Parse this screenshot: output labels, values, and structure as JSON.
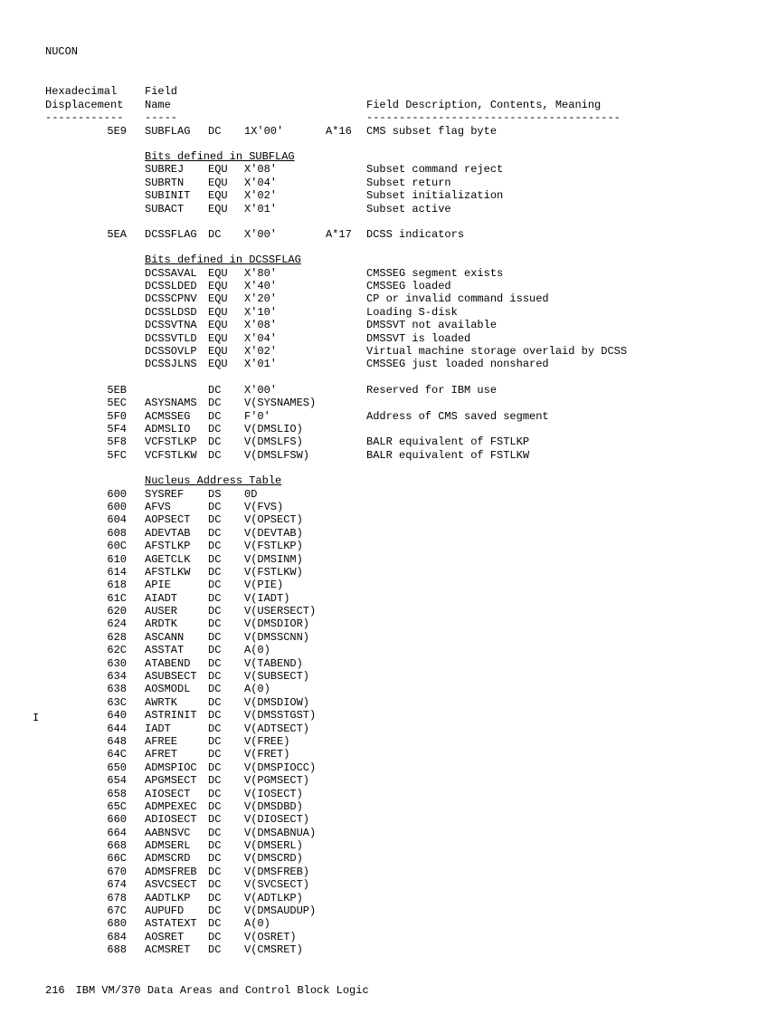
{
  "doc": {
    "header": "NUCON",
    "col_header1a": "Hexadecimal",
    "col_header1b": "Displacement",
    "col_header2a": "Field",
    "col_header2b": "Name",
    "col_header3": "Field Description, Contents, Meaning",
    "dash1": "------------",
    "dash2": "-----",
    "dash3": "---------------------------------------",
    "section1": "Bits defined in SUBFLAG",
    "section2": "Bits defined in DCSSFLAG",
    "section3": "Nucleus Address Table",
    "footer_page": "216",
    "footer_title": "IBM VM/370 Data Areas and Control Block Logic",
    "side_mark": "I"
  },
  "rows": {
    "r1": {
      "disp": "5E9",
      "name": "SUBFLAG",
      "op": "DC",
      "val": "1X'00'",
      "mod": "A*16",
      "desc": "CMS subset flag byte"
    },
    "r2": {
      "disp": "",
      "name": "SUBREJ",
      "op": "EQU",
      "val": "X'08'",
      "mod": "",
      "desc": "Subset command reject"
    },
    "r3": {
      "disp": "",
      "name": "SUBRTN",
      "op": "EQU",
      "val": "X'04'",
      "mod": "",
      "desc": "Subset return"
    },
    "r4": {
      "disp": "",
      "name": "SUBINIT",
      "op": "EQU",
      "val": "X'02'",
      "mod": "",
      "desc": "Subset initialization"
    },
    "r5": {
      "disp": "",
      "name": "SUBACT",
      "op": "EQU",
      "val": "X'01'",
      "mod": "",
      "desc": "Subset active"
    },
    "r6": {
      "disp": "5EA",
      "name": "DCSSFLAG",
      "op": "DC",
      "val": "X'00'",
      "mod": "A*17",
      "desc": "DCSS indicators"
    },
    "r7": {
      "disp": "",
      "name": "DCSSAVAL",
      "op": "EQU",
      "val": "X'80'",
      "mod": "",
      "desc": "CMSSEG segment exists"
    },
    "r8": {
      "disp": "",
      "name": "DCSSLDED",
      "op": "EQU",
      "val": "X'40'",
      "mod": "",
      "desc": "CMSSEG loaded"
    },
    "r9": {
      "disp": "",
      "name": "DCSSCPNV",
      "op": "EQU",
      "val": "X'20'",
      "mod": "",
      "desc": "CP or invalid command issued"
    },
    "r10": {
      "disp": "",
      "name": "DCSSLDSD",
      "op": "EQU",
      "val": "X'10'",
      "mod": "",
      "desc": "Loading S-disk"
    },
    "r11": {
      "disp": "",
      "name": "DCSSVTNA",
      "op": "EQU",
      "val": "X'08'",
      "mod": "",
      "desc": "DMSSVT not available"
    },
    "r12": {
      "disp": "",
      "name": "DCSSVTLD",
      "op": "EQU",
      "val": "X'04'",
      "mod": "",
      "desc": "DMSSVT is loaded"
    },
    "r13": {
      "disp": "",
      "name": "DCSSOVLP",
      "op": "EQU",
      "val": "X'02'",
      "mod": "",
      "desc": "Virtual machine storage overlaid by DCSS"
    },
    "r14": {
      "disp": "",
      "name": "DCSSJLNS",
      "op": "EQU",
      "val": "X'01'",
      "mod": "",
      "desc": "CMSSEG just loaded nonshared"
    },
    "r15": {
      "disp": "5EB",
      "name": "",
      "op": "DC",
      "val": "X'00'",
      "mod": "",
      "desc": "Reserved for IBM use"
    },
    "r16": {
      "disp": "5EC",
      "name": "ASYSNAMS",
      "op": "DC",
      "val": "V(SYSNAMES)",
      "mod": "",
      "desc": ""
    },
    "r17": {
      "disp": "5F0",
      "name": "ACMSSEG",
      "op": "DC",
      "val": "F'0'",
      "mod": "",
      "desc": "Address of CMS saved segment"
    },
    "r18": {
      "disp": "5F4",
      "name": "ADMSLIO",
      "op": "DC",
      "val": "V(DMSLIO)",
      "mod": "",
      "desc": ""
    },
    "r19": {
      "disp": "5F8",
      "name": "VCFSTLKP",
      "op": "DC",
      "val": "V(DMSLFS)",
      "mod": "",
      "desc": "BALR equivalent of FSTLKP"
    },
    "r20": {
      "disp": "5FC",
      "name": "VCFSTLKW",
      "op": "DC",
      "val": "V(DMSLFSW)",
      "mod": "",
      "desc": "BALR equivalent of FSTLKW"
    },
    "r21": {
      "disp": "600",
      "name": "SYSREF",
      "op": "DS",
      "val": "0D",
      "mod": "",
      "desc": ""
    },
    "r22": {
      "disp": "600",
      "name": "AFVS",
      "op": "DC",
      "val": "V(FVS)",
      "mod": "",
      "desc": ""
    },
    "r23": {
      "disp": "604",
      "name": "AOPSECT",
      "op": "DC",
      "val": "V(OPSECT)",
      "mod": "",
      "desc": ""
    },
    "r24": {
      "disp": "608",
      "name": "ADEVTAB",
      "op": "DC",
      "val": "V(DEVTAB)",
      "mod": "",
      "desc": ""
    },
    "r25": {
      "disp": "60C",
      "name": "AFSTLKP",
      "op": "DC",
      "val": "V(FSTLKP)",
      "mod": "",
      "desc": ""
    },
    "r26": {
      "disp": "610",
      "name": "AGETCLK",
      "op": "DC",
      "val": "V(DMSINM)",
      "mod": "",
      "desc": ""
    },
    "r27": {
      "disp": "614",
      "name": "AFSTLKW",
      "op": "DC",
      "val": "V(FSTLKW)",
      "mod": "",
      "desc": ""
    },
    "r28": {
      "disp": "618",
      "name": "APIE",
      "op": "DC",
      "val": "V(PIE)",
      "mod": "",
      "desc": ""
    },
    "r29": {
      "disp": "61C",
      "name": "AIADT",
      "op": "DC",
      "val": "V(IADT)",
      "mod": "",
      "desc": ""
    },
    "r30": {
      "disp": "620",
      "name": "AUSER",
      "op": "DC",
      "val": "V(USERSECT)",
      "mod": "",
      "desc": ""
    },
    "r31": {
      "disp": "624",
      "name": "ARDTK",
      "op": "DC",
      "val": "V(DMSDIOR)",
      "mod": "",
      "desc": ""
    },
    "r32": {
      "disp": "628",
      "name": "ASCANN",
      "op": "DC",
      "val": "V(DMSSCNN)",
      "mod": "",
      "desc": ""
    },
    "r33": {
      "disp": "62C",
      "name": "ASSTAT",
      "op": "DC",
      "val": "A(0)",
      "mod": "",
      "desc": ""
    },
    "r34": {
      "disp": "630",
      "name": "ATABEND",
      "op": "DC",
      "val": "V(TABEND)",
      "mod": "",
      "desc": ""
    },
    "r35": {
      "disp": "634",
      "name": "ASUBSECT",
      "op": "DC",
      "val": "V(SUBSECT)",
      "mod": "",
      "desc": ""
    },
    "r36": {
      "disp": "638",
      "name": "AOSMODL",
      "op": "DC",
      "val": "A(0)",
      "mod": "",
      "desc": ""
    },
    "r37": {
      "disp": "63C",
      "name": "AWRTK",
      "op": "DC",
      "val": "V(DMSDIOW)",
      "mod": "",
      "desc": ""
    },
    "r38": {
      "disp": "640",
      "name": "ASTRINIT",
      "op": "DC",
      "val": "V(DMSSTGST)",
      "mod": "",
      "desc": ""
    },
    "r39": {
      "disp": "644",
      "name": "IADT",
      "op": "DC",
      "val": "V(ADTSECT)",
      "mod": "",
      "desc": ""
    },
    "r40": {
      "disp": "648",
      "name": "AFREE",
      "op": "DC",
      "val": "V(FREE)",
      "mod": "",
      "desc": ""
    },
    "r41": {
      "disp": "64C",
      "name": "AFRET",
      "op": "DC",
      "val": "V(FRET)",
      "mod": "",
      "desc": ""
    },
    "r42": {
      "disp": "650",
      "name": "ADMSPIOC",
      "op": "DC",
      "val": "V(DMSPIOCC)",
      "mod": "",
      "desc": ""
    },
    "r43": {
      "disp": "654",
      "name": "APGMSECT",
      "op": "DC",
      "val": "V(PGMSECT)",
      "mod": "",
      "desc": ""
    },
    "r44": {
      "disp": "658",
      "name": "AIOSECT",
      "op": "DC",
      "val": "V(IOSECT)",
      "mod": "",
      "desc": ""
    },
    "r45": {
      "disp": "65C",
      "name": "ADMPEXEC",
      "op": "DC",
      "val": "V(DMSDBD)",
      "mod": "",
      "desc": ""
    },
    "r46": {
      "disp": "660",
      "name": "ADIOSECT",
      "op": "DC",
      "val": "V(DIOSECT)",
      "mod": "",
      "desc": ""
    },
    "r47": {
      "disp": "664",
      "name": "AABNSVC",
      "op": "DC",
      "val": "V(DMSABNUA)",
      "mod": "",
      "desc": ""
    },
    "r48": {
      "disp": "668",
      "name": "ADMSERL",
      "op": "DC",
      "val": "V(DMSERL)",
      "mod": "",
      "desc": ""
    },
    "r49": {
      "disp": "66C",
      "name": "ADMSCRD",
      "op": "DC",
      "val": "V(DMSCRD)",
      "mod": "",
      "desc": ""
    },
    "r50": {
      "disp": "670",
      "name": "ADMSFREB",
      "op": "DC",
      "val": "V(DMSFREB)",
      "mod": "",
      "desc": ""
    },
    "r51": {
      "disp": "674",
      "name": "ASVCSECT",
      "op": "DC",
      "val": "V(SVCSECT)",
      "mod": "",
      "desc": ""
    },
    "r52": {
      "disp": "678",
      "name": "AADTLKP",
      "op": "DC",
      "val": "V(ADTLKP)",
      "mod": "",
      "desc": ""
    },
    "r53": {
      "disp": "67C",
      "name": "AUPUFD",
      "op": "DC",
      "val": "V(DMSAUDUP)",
      "mod": "",
      "desc": ""
    },
    "r54": {
      "disp": "680",
      "name": "ASTATEXT",
      "op": "DC",
      "val": "A(0)",
      "mod": "",
      "desc": ""
    },
    "r55": {
      "disp": "684",
      "name": "AOSRET",
      "op": "DC",
      "val": "V(OSRET)",
      "mod": "",
      "desc": ""
    },
    "r56": {
      "disp": "688",
      "name": "ACMSRET",
      "op": "DC",
      "val": "V(CMSRET)",
      "mod": "",
      "desc": ""
    }
  }
}
